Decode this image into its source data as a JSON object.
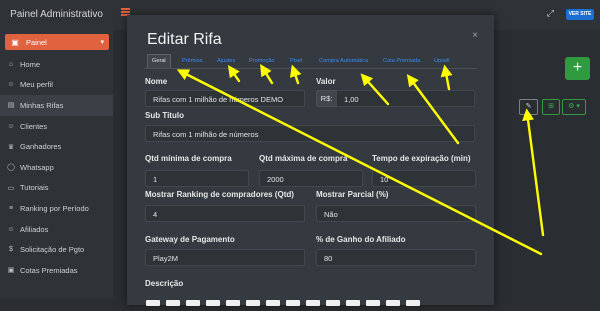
{
  "app": {
    "brand": "Painel Administrativo",
    "user_label": "Painel"
  },
  "sidebar": {
    "items": [
      {
        "label": "Home",
        "icon": "home-icon",
        "glyph": "⌂"
      },
      {
        "label": "Meu perfil",
        "icon": "user-icon",
        "glyph": "☺"
      },
      {
        "label": "Minhas Rifas",
        "icon": "ticket-icon",
        "glyph": "▤"
      },
      {
        "label": "Clientes",
        "icon": "users-icon",
        "glyph": "☺"
      },
      {
        "label": "Ganhadores",
        "icon": "trophy-icon",
        "glyph": "♛"
      },
      {
        "label": "Whatsapp",
        "icon": "whatsapp-icon",
        "glyph": "◯"
      },
      {
        "label": "Tutoriais",
        "icon": "video-icon",
        "glyph": "▭"
      },
      {
        "label": "Ranking por Período",
        "icon": "ranking-icon",
        "glyph": "≡"
      },
      {
        "label": "Afiliados",
        "icon": "affiliates-icon",
        "glyph": "☺"
      },
      {
        "label": "Solicitação de Pgto",
        "icon": "dollar-icon",
        "glyph": "$"
      },
      {
        "label": "Cotas Premiadas",
        "icon": "gift-icon",
        "glyph": "▣"
      }
    ],
    "active_index": 2
  },
  "topbar": {
    "site_button": "VER SITE"
  },
  "modal": {
    "title": "Editar Rifa",
    "close": "×",
    "tabs": [
      "Geral",
      "Prêmios",
      "Ajustes",
      "Promoção",
      "Pixel",
      "Compra Automática",
      "Cota Premiada",
      "Upsell"
    ],
    "active_tab": "Geral",
    "fields": {
      "nome": {
        "label": "Nome",
        "value": "Rifas com 1 milhão de números DEMO"
      },
      "valor": {
        "label": "Valor",
        "prefix": "R$:",
        "value": "1,00"
      },
      "subtitulo": {
        "label": "Sub Titulo",
        "value": "Rifas com 1 milhão de números"
      },
      "qtd_min": {
        "label": "Qtd mínima de compra",
        "value": "1"
      },
      "qtd_max": {
        "label": "Qtd máxima de compra",
        "value": "2000"
      },
      "tempo": {
        "label": "Tempo de expiração (min)",
        "value": "10"
      },
      "ranking": {
        "label": "Mostrar Ranking de compradores (Qtd)",
        "value": "4"
      },
      "parcial": {
        "label": "Mostrar Parcial (%)",
        "value": "Não"
      },
      "gateway": {
        "label": "Gateway de Pagamento",
        "value": "Play2M"
      },
      "ganho": {
        "label": "% de Ganho do Afiliado",
        "value": "80"
      },
      "descricao": {
        "label": "Descrição"
      }
    }
  },
  "colors": {
    "accent": "#e0623f",
    "arrow": "#ffff00",
    "link": "#3b8cf0",
    "success": "#2f9a3e"
  }
}
